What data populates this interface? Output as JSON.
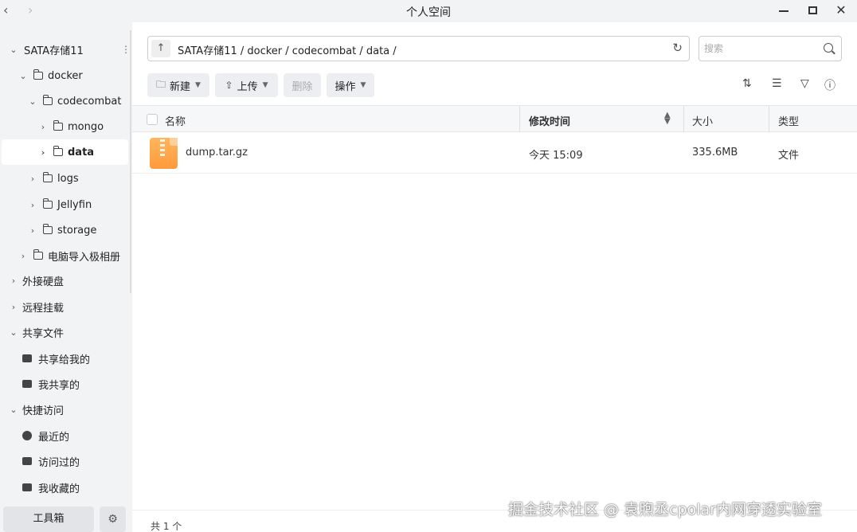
{
  "window": {
    "title": "个人空间",
    "back_icon": "chevron-left-icon",
    "forward_icon": "chevron-right-icon"
  },
  "sidebar": {
    "tree": [
      {
        "label": "SATA存储11",
        "expanded": true
      },
      {
        "label": "docker",
        "expanded": true
      },
      {
        "label": "codecombat",
        "expanded": true
      },
      {
        "label": "mongo",
        "expanded": false
      },
      {
        "label": "data",
        "expanded": false,
        "selected": true
      },
      {
        "label": "logs",
        "expanded": false
      },
      {
        "label": "Jellyfin",
        "expanded": false
      },
      {
        "label": "storage",
        "expanded": false
      },
      {
        "label": "电脑导入极相册",
        "expanded": false
      }
    ],
    "sections": {
      "external": "外接硬盘",
      "remote": "远程挂载",
      "shared": "共享文件",
      "shared_to_me": "共享给我的",
      "my_shared": "我共享的",
      "quick": "快捷访问",
      "recent": "最近的",
      "visited": "访问过的",
      "favorites": "我收藏的"
    },
    "toolbox": "工具箱"
  },
  "pathbar": {
    "path": "SATA存储11 / docker / codecombat / data /"
  },
  "search": {
    "placeholder": "搜索",
    "value": ""
  },
  "toolbar": {
    "new": "新建",
    "upload": "上传",
    "delete": "删除",
    "actions": "操作"
  },
  "table": {
    "headers": {
      "name": "名称",
      "modified": "修改时间",
      "size": "大小",
      "type": "类型"
    },
    "rows": [
      {
        "name": "dump.tar.gz",
        "modified": "今天 15:09",
        "size": "335.6MB",
        "type": "文件"
      }
    ]
  },
  "footer": {
    "count": "共 1 个"
  },
  "watermark": "掘金技术社区 @ 袁煦丞cpolar内网穿透实验室",
  "colors": {
    "zip_icon": "#ff9a3c",
    "sidebar_bg": "#f2f3f5"
  }
}
